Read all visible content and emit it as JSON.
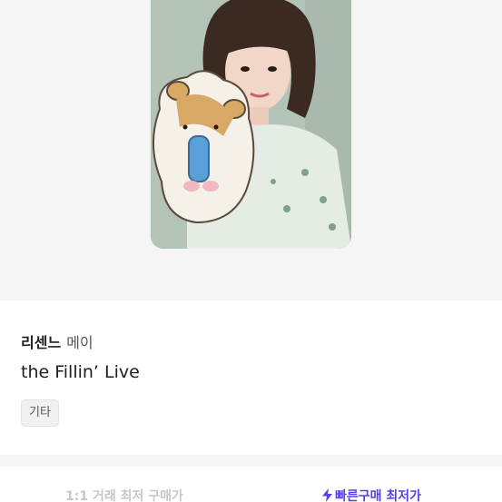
{
  "product": {
    "artist": "리센느",
    "member": "메이",
    "album": "the Fillin’ Live",
    "tag": "기타"
  },
  "bottom_bar": {
    "left_label": "1:1 거래 최저 구매가",
    "right_label": "빠른구매 최저가",
    "right_icon": "lightning-icon"
  },
  "colors": {
    "accent": "#5b3de8",
    "muted": "#c7c7c7",
    "section_bg": "#f5f5f5"
  }
}
